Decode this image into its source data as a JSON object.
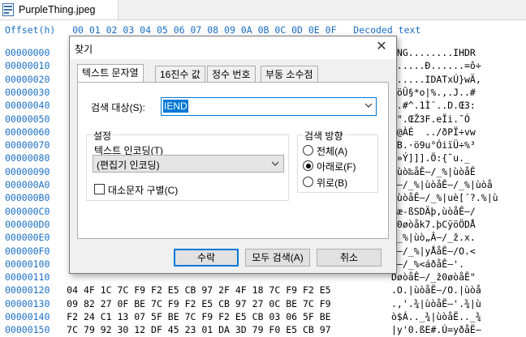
{
  "tab": {
    "file_name": "PurpleThing.jpeg"
  },
  "hex": {
    "header_offset": "Offset(h)",
    "header_cols": "00 01 02 03 04 05 06 07 08 09 0A 0B 0C 0D 0E 0F",
    "header_text": "Decoded text",
    "rows": [
      {
        "offset": "00000000",
        "bytes": "",
        "text": "PNG........IHDR"
      },
      {
        "offset": "00000010",
        "bytes": "",
        "text": "......Ð......=ô÷"
      },
      {
        "offset": "00000020",
        "bytes": "",
        "text": "......IDATxÚ}wÄ,"
      },
      {
        "offset": "00000030",
        "bytes": "",
        "text": "•öÛ§*o|%.,.J..#"
      },
      {
        "offset": "00000040",
        "bytes": "",
        "text": "f.#^.1Ì¨..D.Œ3:"
      },
      {
        "offset": "00000050",
        "bytes": "",
        "text": "$\".ŒŽ3F.eÏi.˜Ó"
      },
      {
        "offset": "00000060",
        "bytes": "",
        "text": "s@ÀÉ  ../ðPÏ÷vw"
      },
      {
        "offset": "00000070",
        "bytes": "",
        "text": "ÜB.·ö9u°ÓiïÜ÷%³"
      },
      {
        "offset": "00000080",
        "bytes": "",
        "text": "á»Ý]]].Ö:{¯u._"
      },
      {
        "offset": "00000090",
        "bytes": "",
        "text": "|ùò‰åÊ–/_%|ùòåÊ"
      },
      {
        "offset": "000000A0",
        "bytes": "",
        "text": "Ê–/_%|ùòåÊ–/_%|ùòå"
      },
      {
        "offset": "000000B0",
        "bytes": "",
        "text": "|ùòåÊ–/_%|uè[´?.%|ù"
      },
      {
        "offset": "000000C0",
        "bytes": "",
        "text": "bæ-ßSDÄþ,ùòåÊ–/"
      },
      {
        "offset": "000000D0",
        "bytes": "",
        "text": "ž0øòåk7.þCÿöÖDÅ"
      },
      {
        "offset": "000000E0",
        "bytes": "",
        "text": "/_%|ùò„Â–/_ž.x."
      },
      {
        "offset": "000000F0",
        "bytes": "",
        "text": "Ê–/_%|yÅåÊ–/O.<"
      },
      {
        "offset": "00000100",
        "bytes": "",
        "text": "ð–/_%<áðåÊ–'."
      },
      {
        "offset": "00000110",
        "bytes": "",
        "text": "DøòåÊ–/_ž0øòåÊ\""
      },
      {
        "offset": "00000120",
        "bytes": "04 4F 1C 7C F9 F2 E5 CB 97 2F 4F 18 7C F9 F2 E5",
        "text": ".O.|ùòåË—/O.|ùòå"
      },
      {
        "offset": "00000130",
        "bytes": "09 82 27 0F BE 7C F9 F2 E5 CB 97 27 0C BE 7C F9",
        "text": ".‚'.¾|ùòåË—'.¾|ù"
      },
      {
        "offset": "00000140",
        "bytes": "F2 24 C1 13 07 5F BE 7C F9 F2 E5 CB 03 06 5F BE",
        "text": "ò$Á.._¾|ùòåË.._¾"
      },
      {
        "offset": "00000150",
        "bytes": "7C 79 92 30 12 DF 45 23 01 DA 3D 79 F0 E5 CB 97",
        "text": "|y'0.ßE#.Ú=yðåË—"
      }
    ]
  },
  "dialog": {
    "title": "찾기",
    "tabs": [
      "텍스트 문자열",
      "16진수 값",
      "정수 번호",
      "부동 소수점"
    ],
    "search_target_label": "검색 대상(S):",
    "search_value": "IEND",
    "settings_label": "설정",
    "encoding_label": "텍스트 인코딩(T)",
    "encoding_value": "(편집기 인코딩)",
    "case_label": "대소문자 구별(C)",
    "direction_label": "검색 방향",
    "radio_all": "전체(A)",
    "radio_down": "아래로(F)",
    "radio_up": "위로(B)",
    "btn_ok": "수락",
    "btn_findall": "모두 검색(A)",
    "btn_cancel": "취소"
  }
}
